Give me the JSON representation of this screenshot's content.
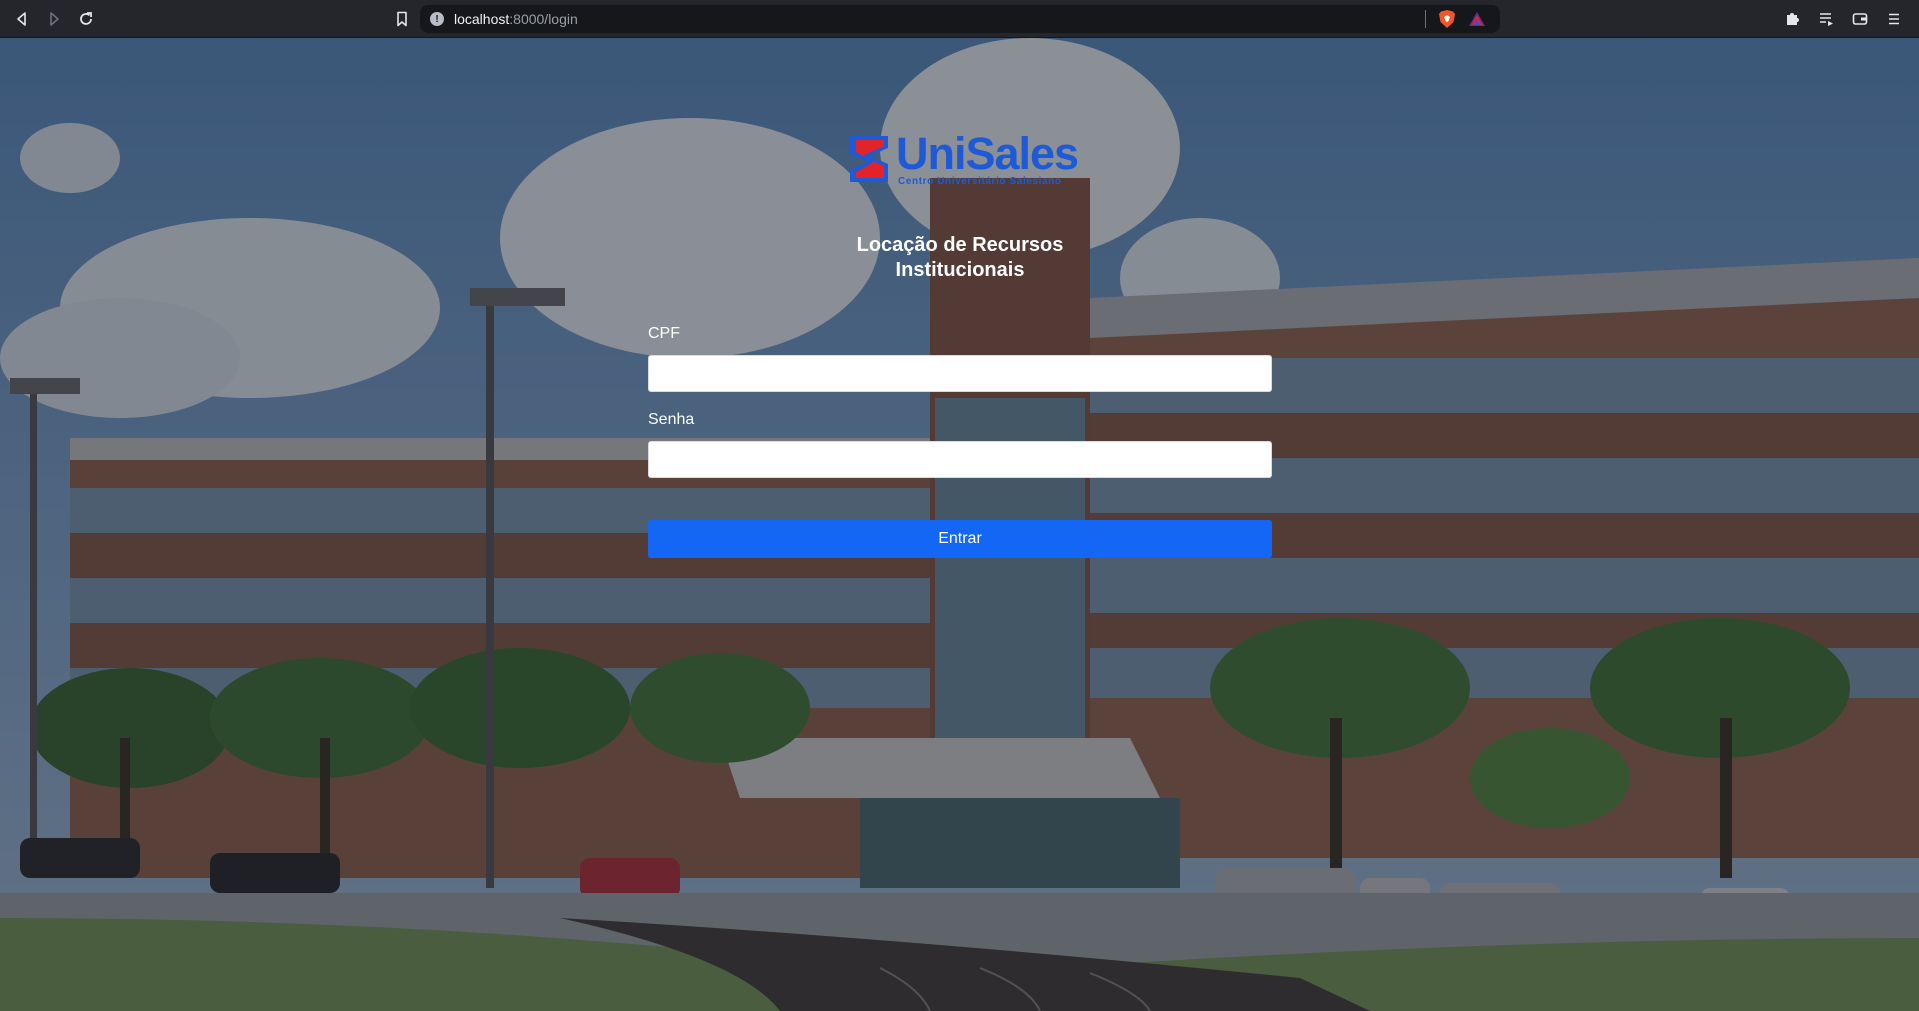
{
  "browser": {
    "url_host": "localhost",
    "url_rest": ":8000/login"
  },
  "logo": {
    "name": "UniSales",
    "subtitle": "Centro Universitário Salesiano"
  },
  "page": {
    "title_line1": "Locação de Recursos",
    "title_line2": "Institucionais"
  },
  "form": {
    "cpf_label": "CPF",
    "cpf_value": "",
    "password_label": "Senha",
    "password_value": "",
    "submit_label": "Entrar"
  },
  "colors": {
    "accent": "#1466f5",
    "brand_blue": "#1f5ad6",
    "brand_red": "#e2232a"
  }
}
